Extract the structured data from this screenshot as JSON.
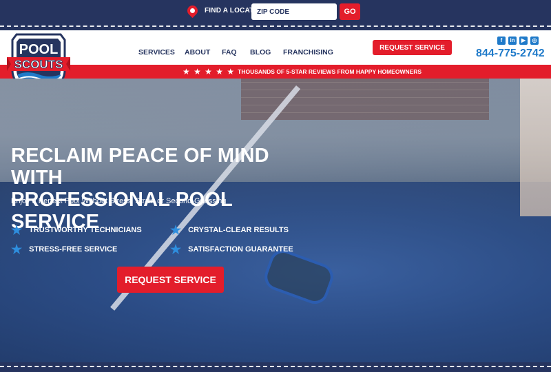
{
  "location": {
    "label": "FIND A LOCATION",
    "zip_placeholder": "ZIP CODE",
    "go_label": "GO"
  },
  "logo": {
    "line1": "POOL",
    "line2": "SCOUTS",
    "colors": {
      "navy": "#26345f",
      "red": "#e31d2b",
      "blue": "#1f7ac9"
    }
  },
  "nav": {
    "items": [
      {
        "label": "SERVICES"
      },
      {
        "label": "ABOUT"
      },
      {
        "label": "FAQ"
      },
      {
        "label": "BLOG"
      },
      {
        "label": "FRANCHISING"
      }
    ],
    "request_label": "REQUEST SERVICE",
    "phone": "844-775-2742",
    "socials": [
      {
        "icon": "facebook-icon",
        "glyph": "f"
      },
      {
        "icon": "linkedin-icon",
        "glyph": "in"
      },
      {
        "icon": "youtube-icon",
        "glyph": "▶"
      },
      {
        "icon": "instagram-icon",
        "glyph": "◎"
      }
    ]
  },
  "reviews": {
    "stars": "★ ★ ★ ★ ★",
    "text": "THOUSANDS OF 5-STAR REVIEWS FROM HAPPY HOMEOWNERS"
  },
  "hero": {
    "title_line1": "RECLAIM PEACE OF MIND WITH",
    "title_line2": "PROFESSIONAL POOL SERVICE",
    "subtitle": "Enjoy a Perfect Pool Without Stress, Strain or Second-Guessing",
    "benefits": [
      {
        "label": "TRUSTWORTHY TECHNICIANS"
      },
      {
        "label": "CRYSTAL-CLEAR RESULTS"
      },
      {
        "label": "STRESS-FREE SERVICE"
      },
      {
        "label": "SATISFACTION GUARANTEE"
      }
    ],
    "cta_label": "REQUEST SERVICE"
  }
}
